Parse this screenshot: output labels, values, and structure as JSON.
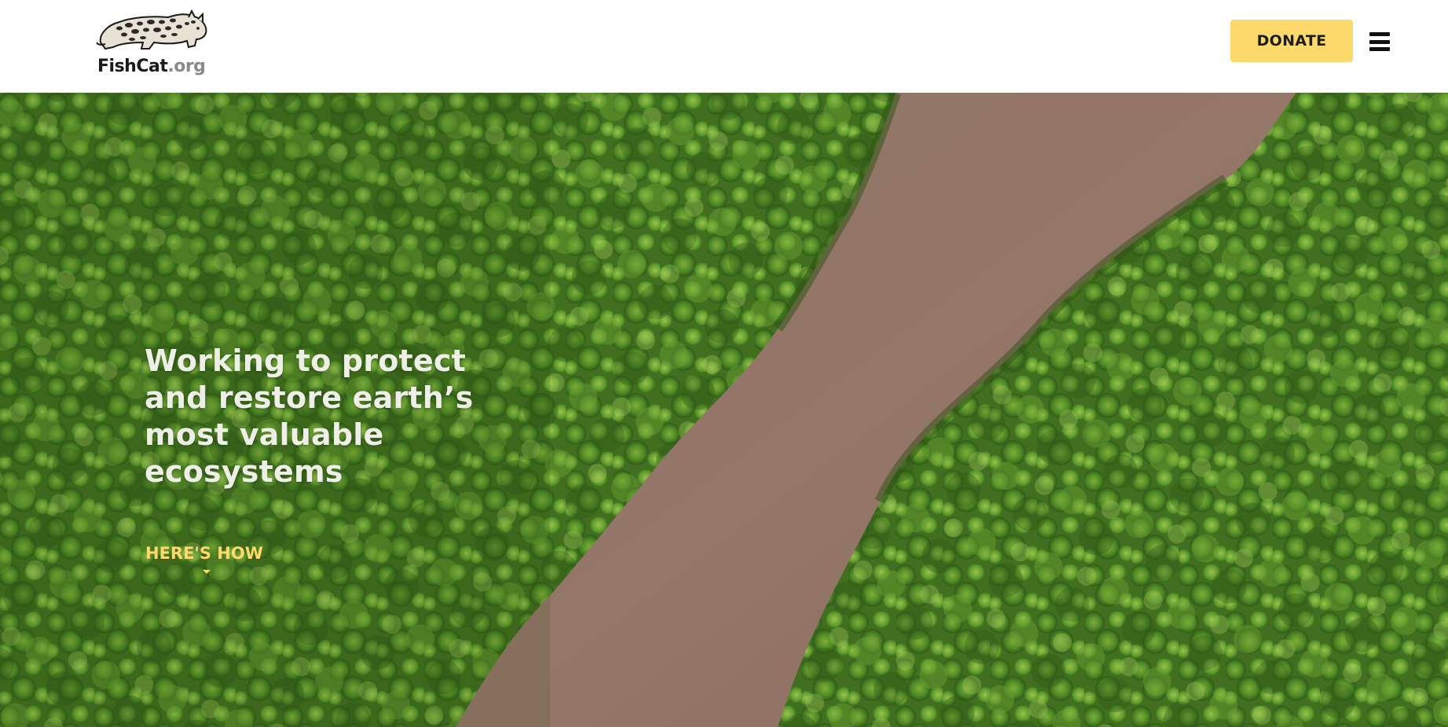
{
  "header": {
    "logo": {
      "name": "FishCat",
      "suffix": ".org"
    },
    "donate_label": "DONATE",
    "menu_icon": "hamburger-menu-icon"
  },
  "hero": {
    "headline": "Working to protect and restore earth’s most valuable ecosystems",
    "cta_label": "HERE'S HOW",
    "cta_icon": "caret-down-icon",
    "background": "aerial photo of a brown river winding through green mangrove forest"
  },
  "colors": {
    "accent": "#fdd86b",
    "header_bg": "#ffffff",
    "headline_text": "#eef0e8",
    "forest": "#3f6e1f",
    "river": "#8d7467"
  }
}
